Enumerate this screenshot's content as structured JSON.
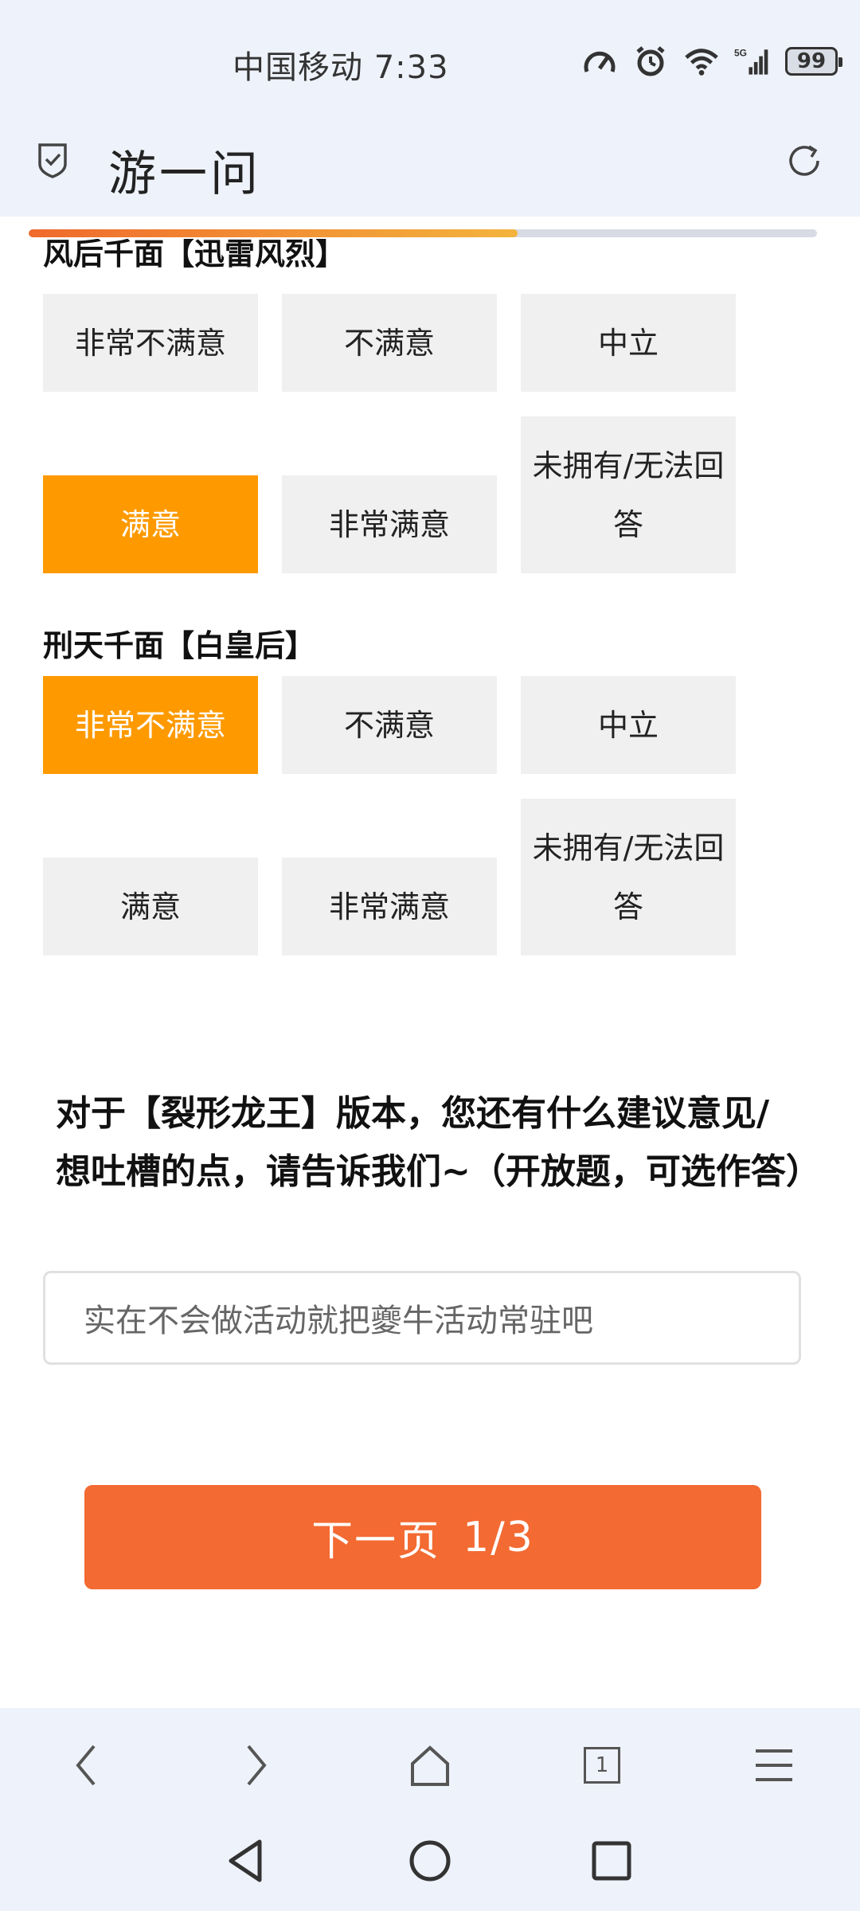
{
  "status_bar": {
    "carrier_time": "中国移动 7:33",
    "battery": "99",
    "network": "5G"
  },
  "app_bar": {
    "title": "游一问"
  },
  "progress": {
    "fraction": 0.62
  },
  "question_1": {
    "title": "风后千面【迅雷风烈】",
    "options": [
      "非常不满意",
      "不满意",
      "中立",
      "满意",
      "非常满意",
      "未拥有/无法回答"
    ],
    "selected": "满意"
  },
  "question_2": {
    "title": "刑天千面【白皇后】",
    "options": [
      "非常不满意",
      "不满意",
      "中立",
      "满意",
      "非常满意",
      "未拥有/无法回答"
    ],
    "selected": "非常不满意"
  },
  "open_question": {
    "title": "对于【裂形龙王】版本，您还有什么建议意见/想吐槽的点，请告诉我们~（开放题，可选作答）",
    "answer": "实在不会做活动就把夔牛活动常驻吧"
  },
  "next_button": {
    "label": "下一页",
    "page": "1/3"
  },
  "browser_nav": {
    "tab_count": "1"
  },
  "colors": {
    "selected": "#fe9a00",
    "primary": "#f36a32",
    "unselected": "#f0f0f0"
  }
}
